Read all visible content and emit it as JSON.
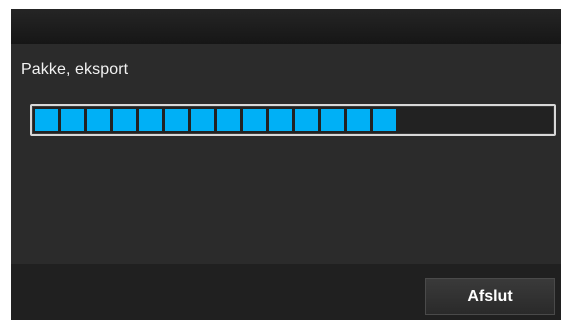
{
  "dialog": {
    "label": "Pakke, eksport",
    "progress": {
      "filled_segments": 14,
      "total_segments": 20,
      "fraction": 0.7,
      "fill_color": "#00b0f6"
    },
    "exit_label": "Afslut"
  }
}
